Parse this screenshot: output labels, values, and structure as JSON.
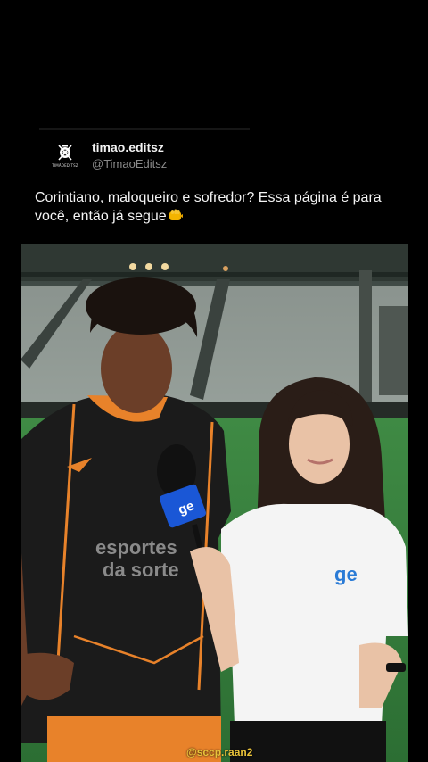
{
  "post": {
    "avatar_icon": "corinthians-crest-icon",
    "avatar_text": "TIMÃOEDITSZ",
    "display_name": "timao.editsz",
    "handle": "@TimaoEditsz",
    "caption": "Corintiano, maloqueiro e sofredor? Essa página é para você, então já segue",
    "caption_emoji": "fist-icon"
  },
  "video": {
    "sponsor_text_1": "esportes",
    "sponsor_text_2": "da sorte",
    "mic_logo": "ge",
    "shirt_logo": "ge",
    "watermark": "@sccp.raan2"
  },
  "colors": {
    "background": "#000000",
    "pitch": "#3a7d3c",
    "kit": "#1a1a1a",
    "kit_trim": "#e8822a",
    "mic_blue": "#1a57d6"
  }
}
